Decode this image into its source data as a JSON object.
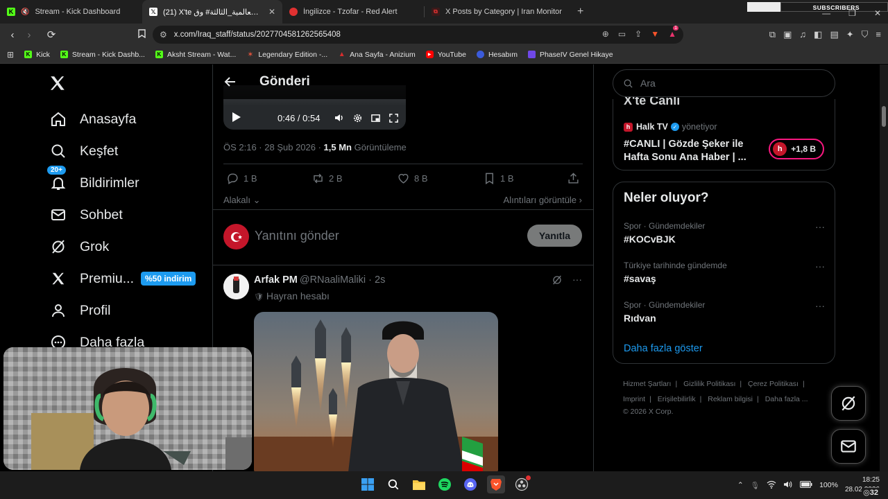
{
  "browser": {
    "tabs": [
      {
        "title": "Stream - Kick Dashboard",
        "active": false
      },
      {
        "title": "(21) X'te الحرب_العالمية_الثالثة# وق",
        "active": true
      },
      {
        "title": "İngilizce - Tzofar - Red Alert",
        "active": false
      },
      {
        "title": "X Posts by Category | Iran Monitor",
        "active": false
      }
    ],
    "close_glyph": "✕",
    "new_tab": "+",
    "url": "x.com/Iraq_staff/status/2027704581262565408",
    "subscribers_label": "SUBSCRIBERS",
    "brave_badge": "1",
    "bookmarks": [
      {
        "label": "Kick",
        "icon": "kick-icon",
        "color": "#53fc18"
      },
      {
        "label": "Stream - Kick Dashb...",
        "icon": "kick-icon",
        "color": "#53fc18"
      },
      {
        "label": "Aksht Stream - Wat...",
        "icon": "kick-icon",
        "color": "#53fc18"
      },
      {
        "label": "Legendary Edition -...",
        "icon": "star-icon",
        "color": "#e0533c"
      },
      {
        "label": "Ana Sayfa - Anizium",
        "icon": "anizium-icon",
        "color": "#d62d2d"
      },
      {
        "label": "YouTube",
        "icon": "youtube-icon",
        "color": "#ff0000"
      },
      {
        "label": "Hesabım",
        "icon": "account-icon",
        "color": "#3b5bdb"
      },
      {
        "label": "PhaseIV Genel Hikaye",
        "icon": "phase-icon",
        "color": "#7048e8"
      }
    ]
  },
  "nav": {
    "items": [
      {
        "label": "Anasayfa",
        "icon": "home-icon"
      },
      {
        "label": "Keşfet",
        "icon": "search-icon"
      },
      {
        "label": "Bildirimler",
        "icon": "bell-icon",
        "badge": "20+"
      },
      {
        "label": "Sohbet",
        "icon": "mail-icon"
      },
      {
        "label": "Grok",
        "icon": "grok-icon"
      },
      {
        "label": "Premiu...",
        "icon": "x-icon",
        "promo": "%50 indirim"
      },
      {
        "label": "Profil",
        "icon": "person-icon"
      },
      {
        "label": "Daha fazla",
        "icon": "more-icon"
      }
    ]
  },
  "post": {
    "header_title": "Gönderi",
    "video_time": "0:46 / 0:54",
    "timestamp": "ÖS 2:16 · 28 Şub 2026 · ",
    "views_count": "1,5 Mn",
    "views_label": " Görüntüleme",
    "replies": "1 B",
    "reposts": "2 B",
    "likes": "8 B",
    "bookmarks": "1 B",
    "related_label": "Alakalı",
    "quotes_link": "Alıntıları görüntüle",
    "reply_placeholder": "Yanıtını gönder",
    "reply_button": "Yanıtla"
  },
  "reply_post": {
    "name": "Arfak PM",
    "handle": "@RNaaliMaliki · 2s",
    "subtitle": "Hayran hesabı"
  },
  "sidebar": {
    "search_placeholder": "Ara",
    "live": {
      "title": "X'te Canlı",
      "host": "Halk TV",
      "role": "yönetiyor",
      "text": "#CANLI | Gözde Şeker ile Hafta Sonu Ana Haber | ...",
      "listeners": "+1,8 B"
    },
    "trends_title": "Neler oluyor?",
    "trends": [
      {
        "context": "Spor · Gündemdekiler",
        "topic": "#KOCvBJK"
      },
      {
        "context": "Türkiye tarihinde gündemde",
        "topic": "#savaş"
      },
      {
        "context": "Spor · Gündemdekiler",
        "topic": "Rıdvan"
      }
    ],
    "more_glyph": "···",
    "show_more": "Daha fazla göster",
    "footer": {
      "line1": [
        "Hizmet Şartları",
        "Gizlilik Politikası",
        "Çerez Politikası"
      ],
      "line2": [
        "Imprint",
        "Erişilebilirlik",
        "Reklam bilgisi",
        "Daha fazla ..."
      ],
      "copyright": "© 2026 X Corp."
    }
  },
  "taskbar": {
    "battery": "100%",
    "time": "18:25",
    "date": "28.02.2026",
    "overlay_count": "32"
  },
  "colors": {
    "accent": "#1d9bf0",
    "live_pink": "#f91880",
    "kick_green": "#53fc18"
  }
}
